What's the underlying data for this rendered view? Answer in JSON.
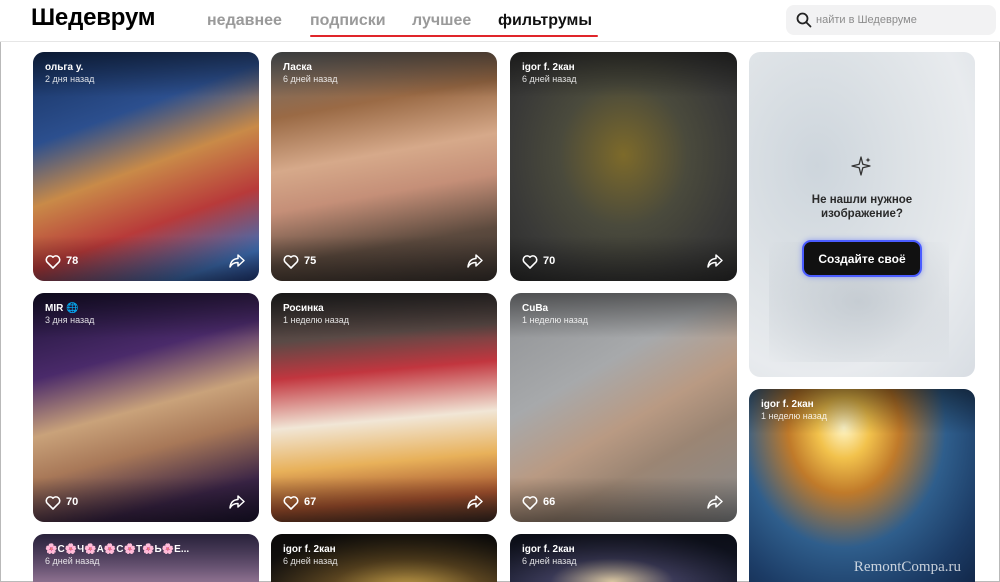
{
  "app": {
    "logo": "Шедеврум"
  },
  "nav": {
    "tabs": [
      {
        "label": "недавнее",
        "active": false
      },
      {
        "label": "подписки",
        "active": false
      },
      {
        "label": "лучшее",
        "active": false
      },
      {
        "label": "фильтрумы",
        "active": true
      }
    ]
  },
  "search": {
    "placeholder": "найти в Шедевруме",
    "icon": "search-icon"
  },
  "colors": {
    "accent_underline": "#e0252a",
    "button_glow": "#4a5cff"
  },
  "cards": [
    {
      "author": "ольга у.",
      "time": "2 дня назад",
      "likes": "78"
    },
    {
      "author": "Ласка",
      "time": "6 дней назад",
      "likes": "75"
    },
    {
      "author": "igor f. 2кан",
      "time": "6 дней назад",
      "likes": "70"
    },
    {
      "author": "MIR 🌐",
      "time": "3 дня назад",
      "likes": "70"
    },
    {
      "author": "Росинка",
      "time": "1 неделю назад",
      "likes": "67"
    },
    {
      "author": "CuBa",
      "time": "1 неделю назад",
      "likes": "66"
    },
    {
      "author": "🌸С🌸Ч🌸А🌸С🌸Т🌸Ь🌸Е...",
      "time": "6 дней назад",
      "likes": ""
    },
    {
      "author": "igor f. 2кан",
      "time": "6 дней назад",
      "likes": ""
    },
    {
      "author": "igor f. 2кан",
      "time": "6 дней назад",
      "likes": ""
    },
    {
      "author": "igor f. 2кан",
      "time": "1 неделю назад",
      "likes": ""
    }
  ],
  "create": {
    "prompt": "Не нашли нужное изображение?",
    "button": "Создайте своё",
    "icon": "sparkle-icon"
  },
  "watermark": "RemontCompa.ru"
}
